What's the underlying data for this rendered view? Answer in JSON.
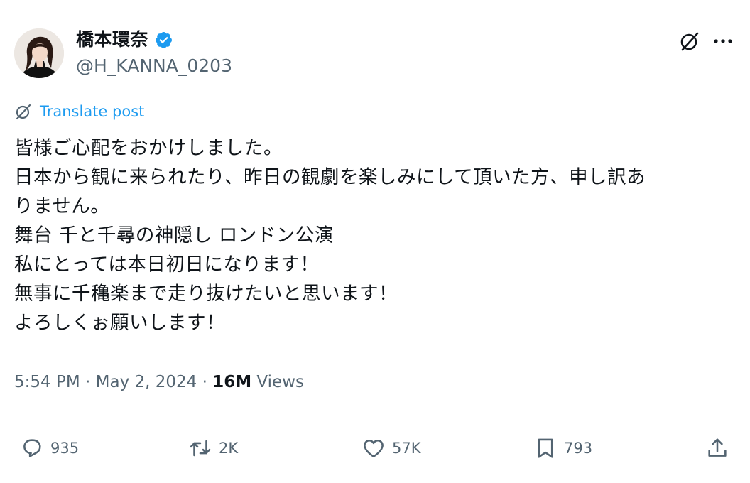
{
  "author": {
    "display_name": "橋本環奈",
    "handle": "@H_KANNA_0203",
    "verified": true,
    "verified_color": "#1d9bf0"
  },
  "header_actions": {
    "grok_icon": "grok-icon",
    "more_icon": "more-options-icon"
  },
  "translate": {
    "label": "Translate post",
    "color": "#1d9bf0"
  },
  "post": {
    "lines": [
      "皆様ご心配をおかけしました。",
      "日本から観に来られたり、昨日の観劇を楽しみにして頂いた方、申し訳あ",
      "りません。",
      "舞台 千と千尋の神隠し ロンドン公演",
      "私にとっては本日初日になります！",
      "無事に千穐楽まで走り抜けたいと思います！",
      "よろしくぉ願いします！"
    ]
  },
  "meta": {
    "time": "5:54 PM",
    "separator": " · ",
    "date": "May 2, 2024",
    "views_count": "16M",
    "views_label": " Views"
  },
  "actions": {
    "replies": "935",
    "reposts": "2K",
    "likes": "57K",
    "bookmarks": "793"
  }
}
